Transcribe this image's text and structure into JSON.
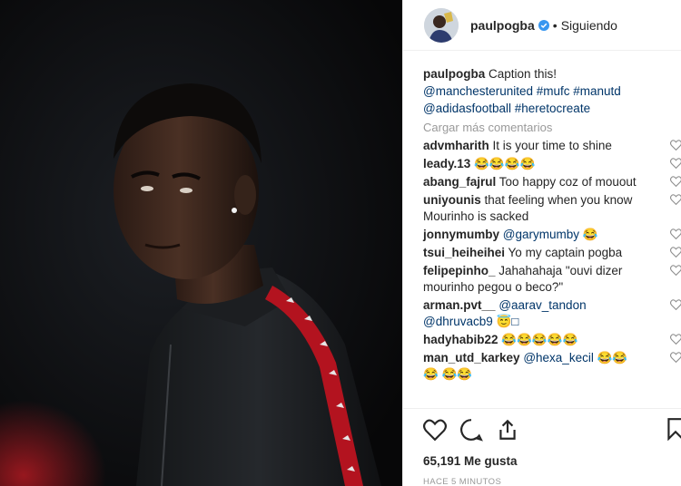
{
  "header": {
    "username": "paulpogba",
    "separator": "•",
    "follow_status": "Siguiendo"
  },
  "caption": {
    "username": "paulpogba",
    "text": "Caption this!",
    "line2": "@manchesterunited #mufc #manutd",
    "line3": "@adidasfootball #heretocreate"
  },
  "load_more": "Cargar más comentarios",
  "comments": [
    {
      "user": "advmharith",
      "text": "It is your time to shine"
    },
    {
      "user": "leady.13",
      "text": "😂😂😂😂"
    },
    {
      "user": "abang_fajrul",
      "text": "Too happy coz of mouout"
    },
    {
      "user": "uniyounis",
      "text": "that feeling when you know Mourinho is sacked"
    },
    {
      "user": "jonnymumby",
      "text": "@garymumby 😂"
    },
    {
      "user": "tsui_heiheihei",
      "text": "Yo my captain pogba"
    },
    {
      "user": "felipepinho_",
      "text": "Jahahahaja \"ouvi dizer mourinho pegou o beco?\""
    },
    {
      "user": "arman.pvt__",
      "text": "@aarav_tandon @dhruvacb9 😇□"
    },
    {
      "user": "hadyhabib22",
      "text": "😂😂😂😂😂"
    },
    {
      "user": "man_utd_karkey",
      "text": "@hexa_kecil 😂😂😂 😂😂"
    }
  ],
  "likes": "65,191 Me gusta",
  "timestamp": "HACE 5 MINUTOS",
  "icons": {
    "verified": "verified-badge-icon",
    "like": "heart-icon",
    "comment": "comment-bubble-icon",
    "share": "share-icon",
    "save": "bookmark-icon"
  },
  "colors": {
    "verified": "#3897f0",
    "link": "#003569",
    "muted": "#999999",
    "photo_bg": "#0b0b0c",
    "stripe": "#c8102e"
  }
}
